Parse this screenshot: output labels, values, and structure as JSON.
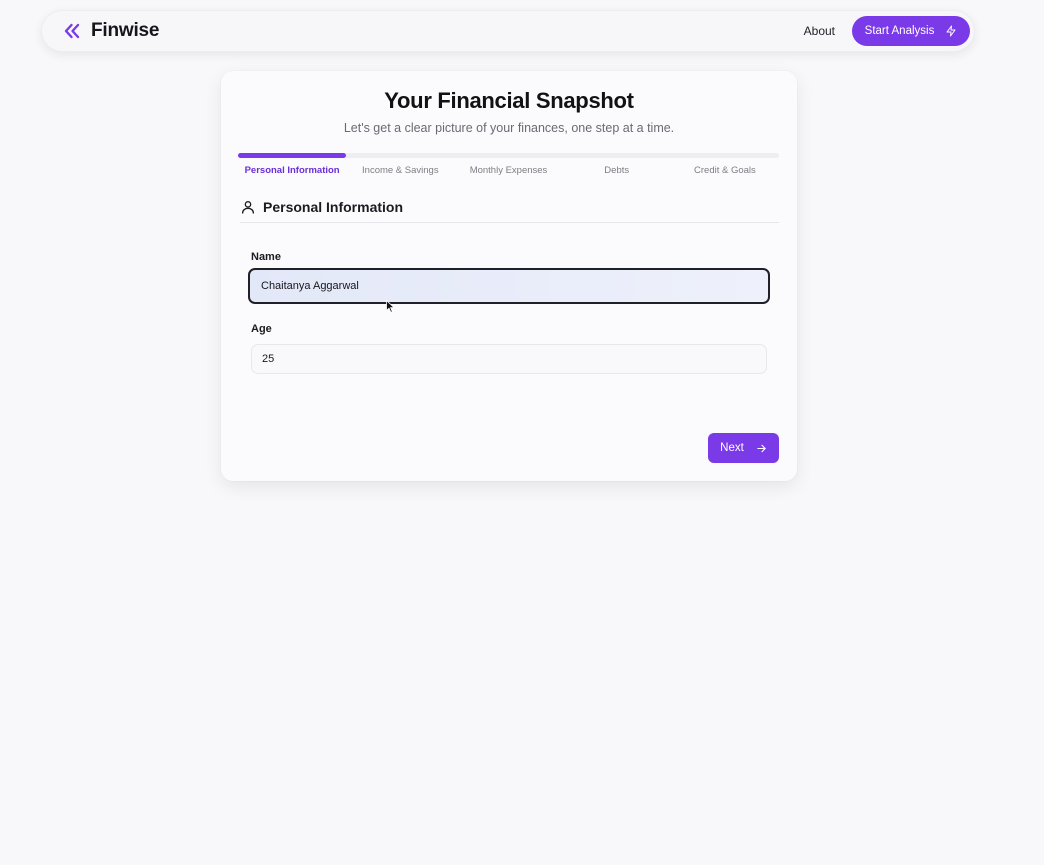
{
  "app": {
    "name": "Finwise"
  },
  "nav": {
    "about": "About",
    "start_analysis": "Start Analysis"
  },
  "card": {
    "title": "Your Financial Snapshot",
    "subtitle": "Let's get a clear picture of your finances, one step at a time."
  },
  "progress": {
    "current_step": 1,
    "total_steps": 5,
    "fraction": 0.2
  },
  "steps": [
    {
      "label": "Personal Information",
      "active": true
    },
    {
      "label": "Income & Savings",
      "active": false
    },
    {
      "label": "Monthly Expenses",
      "active": false
    },
    {
      "label": "Debts",
      "active": false
    },
    {
      "label": "Credit & Goals",
      "active": false
    }
  ],
  "section": {
    "title": "Personal Information",
    "icon": "user-icon"
  },
  "form": {
    "name": {
      "label": "Name",
      "value": "Chaitanya Aggarwal"
    },
    "age": {
      "label": "Age",
      "value": "25"
    }
  },
  "buttons": {
    "next": "Next"
  },
  "colors": {
    "accent": "#7b3ae8",
    "background": "#f8f8fa",
    "card": "#fbfbfd"
  }
}
